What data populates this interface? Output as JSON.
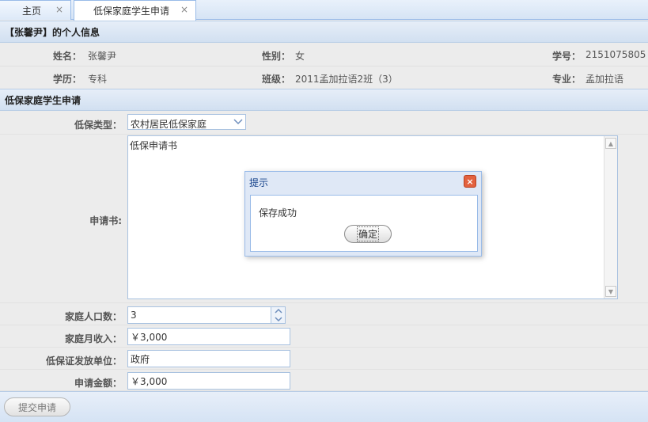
{
  "tabs": [
    {
      "label": "主页"
    },
    {
      "label": "低保家庭学生申请"
    }
  ],
  "tab_close_glyph": "×",
  "personal_info": {
    "header": "【张馨尹】的个人信息",
    "name_label": "姓名：",
    "name": "张馨尹",
    "gender_label": "性别：",
    "gender": "女",
    "student_id_label": "学号：",
    "student_id": "2151075805",
    "education_label": "学历：",
    "education": "专科",
    "class_label": "班级：",
    "class": "2011孟加拉语2班（3）",
    "major_label": "专业：",
    "major": "孟加拉语"
  },
  "application": {
    "header": "低保家庭学生申请",
    "type_label": "低保类型：",
    "type_value": "农村居民低保家庭",
    "letter_label": "申请书:",
    "letter_content": "低保申请书",
    "household_label": "家庭人口数：",
    "household_value": "3",
    "income_label": "家庭月收入：",
    "income_value": "￥3,000",
    "issuer_label": "低保证发放单位：",
    "issuer_value": "政府",
    "amount_label": "申请金额：",
    "amount_value": "￥3,000",
    "submit_label": "提交申请"
  },
  "dialog": {
    "title": "提示",
    "message": "保存成功",
    "ok_label": "确定",
    "close_glyph": "×"
  },
  "icons": {
    "combo_arrow": "chevron-down-icon",
    "spinner_up": "triangle-up-icon",
    "spinner_down": "triangle-down-icon"
  }
}
